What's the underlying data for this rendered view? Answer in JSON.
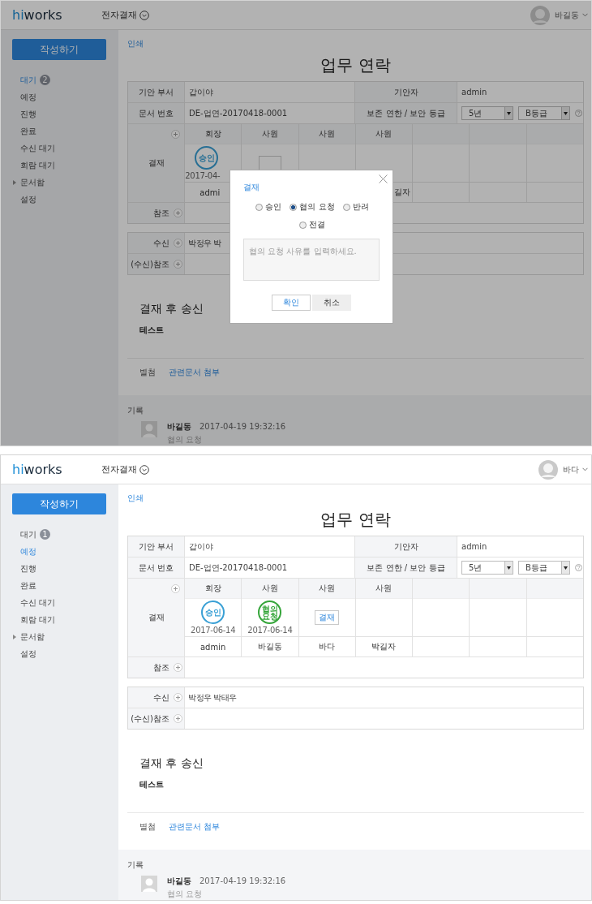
{
  "screens": [
    {
      "header": {
        "logo": "hiworks",
        "app_title": "전자결재",
        "user_name": "바길동"
      },
      "sidebar": {
        "compose_button": "작성하기",
        "items": [
          {
            "label": "대기",
            "badge": "2",
            "selected": true,
            "expandable": false
          },
          {
            "label": "예정",
            "selected": false,
            "expandable": false
          },
          {
            "label": "진행",
            "selected": false,
            "expandable": false
          },
          {
            "label": "완료",
            "selected": false,
            "expandable": false
          },
          {
            "label": "수신 대기",
            "selected": false,
            "expandable": false
          },
          {
            "label": "회람 대기",
            "selected": false,
            "expandable": false
          },
          {
            "label": "문서함",
            "selected": false,
            "expandable": true
          },
          {
            "label": "설정",
            "selected": false,
            "expandable": false
          }
        ]
      },
      "document": {
        "print_link": "인쇄",
        "title": "업무 연락",
        "department_label": "기안 부서",
        "department": "갑이야",
        "drafter_label": "기안자",
        "drafter": "admin",
        "doc_number_label": "문서 번호",
        "doc_number": "DE-업연-20170418-0001",
        "retention_label": "보존 연한 / 보안 등급",
        "retention": "5년",
        "security": "B등급",
        "approval_label": "결재",
        "approvers": [
          {
            "role": "회장",
            "stamp": {
              "kind": "approved",
              "text": "승인",
              "date": "2017-04-"
            },
            "name": "admi",
            "cut_end": true
          },
          {
            "role": "사원",
            "action": {
              "kind": "button"
            }
          },
          {
            "role": "사원"
          },
          {
            "role": "사원",
            "name": "길자",
            "cut_start": true
          }
        ],
        "reference_label": "참조",
        "recipient_label": "수신",
        "recipients": "박정우 박",
        "recipient_reference_label": "(수신)참조",
        "section_title": "결재 후 송신",
        "body": "테스트",
        "attachment_label": "별첨",
        "attachment_link": "관련문서 첨부"
      },
      "history": {
        "label": "기록",
        "entries": [
          {
            "name": "바길동",
            "time": "2017-04-19 19:32:16",
            "text": "협의 요청"
          }
        ]
      },
      "dialog": {
        "title": "결재",
        "options": [
          {
            "label": "승인",
            "selected": false
          },
          {
            "label": "협의 요청",
            "selected": true
          },
          {
            "label": "반려",
            "selected": false
          },
          {
            "label": "전결",
            "selected": false
          }
        ],
        "placeholder": "협의 요청 사유를 입력하세요.",
        "buttons": [
          {
            "label": "확인",
            "kind": "primary"
          },
          {
            "label": "취소",
            "kind": "secondary"
          }
        ]
      }
    },
    {
      "header": {
        "logo": "hiworks",
        "app_title": "전자결재",
        "user_name": "바다"
      },
      "sidebar": {
        "compose_button": "작성하기",
        "items": [
          {
            "label": "대기",
            "badge": "1",
            "selected": false,
            "expandable": false
          },
          {
            "label": "예정",
            "selected": true,
            "expandable": false
          },
          {
            "label": "진행",
            "selected": false,
            "expandable": false
          },
          {
            "label": "완료",
            "selected": false,
            "expandable": false
          },
          {
            "label": "수신 대기",
            "selected": false,
            "expandable": false
          },
          {
            "label": "회람 대기",
            "selected": false,
            "expandable": false
          },
          {
            "label": "문서함",
            "selected": false,
            "expandable": true
          },
          {
            "label": "설정",
            "selected": false,
            "expandable": false
          }
        ]
      },
      "document": {
        "print_link": "인쇄",
        "title": "업무 연락",
        "department_label": "기안 부서",
        "department": "갑이야",
        "drafter_label": "기안자",
        "drafter": "admin",
        "doc_number_label": "문서 번호",
        "doc_number": "DE-업연-20170418-0001",
        "retention_label": "보존 연한 / 보안 등급",
        "retention": "5년",
        "security": "B등급",
        "approval_label": "결재",
        "approvers": [
          {
            "role": "회장",
            "stamp": {
              "kind": "approved",
              "text": "승인",
              "date": "2017-06-14"
            },
            "name": "admin"
          },
          {
            "role": "사원",
            "stamp": {
              "kind": "consult",
              "text": "협의 요청",
              "date": "2017-06-14"
            },
            "name": "바길동"
          },
          {
            "role": "사원",
            "action": {
              "kind": "button",
              "label": "결재"
            },
            "name": "바다"
          },
          {
            "role": "사원",
            "name": "박길자"
          }
        ],
        "reference_label": "참조",
        "recipient_label": "수신",
        "recipients": "박정우 박태우",
        "recipient_reference_label": "(수신)참조",
        "section_title": "결재 후 송신",
        "body": "테스트",
        "attachment_label": "별첨",
        "attachment_link": "관련문서 첨부"
      },
      "history": {
        "label": "기록",
        "entries": [
          {
            "name": "바길동",
            "time": "2017-04-19 19:32:16",
            "text": "협의 요청"
          }
        ]
      }
    }
  ]
}
